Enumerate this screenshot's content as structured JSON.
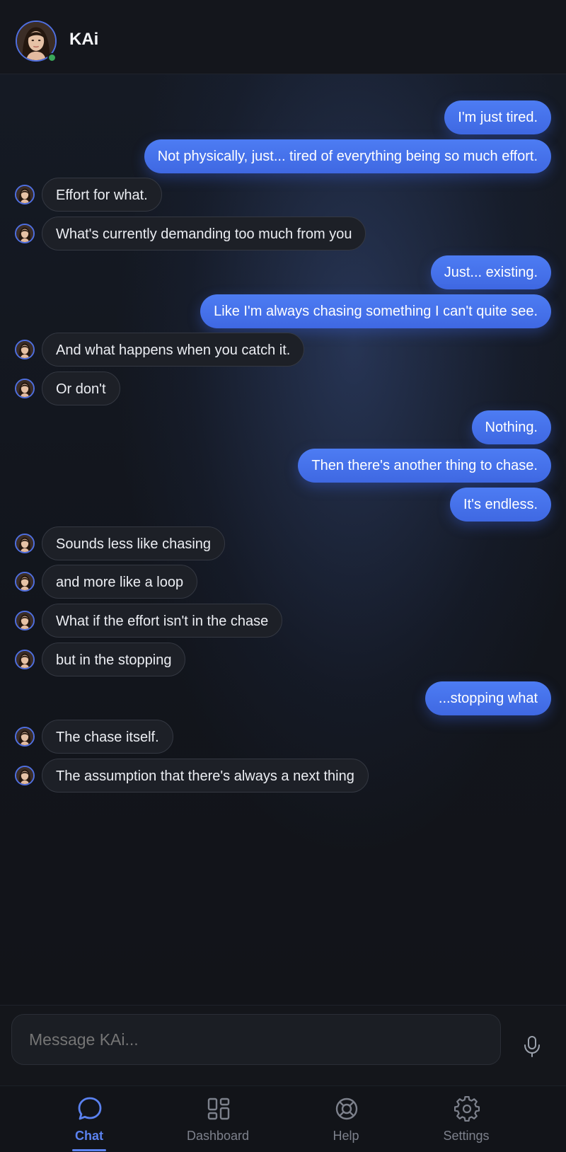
{
  "header": {
    "title": "KAi",
    "avatar_icon": "kai-avatar-portrait",
    "status": "online"
  },
  "messages": [
    {
      "sender": "user",
      "text": "I'm just tired."
    },
    {
      "sender": "user",
      "text": "Not physically, just... tired of everything being so much effort."
    },
    {
      "sender": "bot",
      "text": "Effort for what."
    },
    {
      "sender": "bot",
      "text": "What's currently demanding too much from you"
    },
    {
      "sender": "user",
      "text": "Just... existing."
    },
    {
      "sender": "user",
      "text": "Like I'm always chasing something I can't quite see."
    },
    {
      "sender": "bot",
      "text": "And what happens when you catch it."
    },
    {
      "sender": "bot",
      "text": "Or don't"
    },
    {
      "sender": "user",
      "text": "Nothing."
    },
    {
      "sender": "user",
      "text": "Then there's another thing to chase."
    },
    {
      "sender": "user",
      "text": "It's endless."
    },
    {
      "sender": "bot",
      "text": "Sounds less like chasing"
    },
    {
      "sender": "bot",
      "text": "and more like a loop"
    },
    {
      "sender": "bot",
      "text": "What if the effort isn't in the chase"
    },
    {
      "sender": "bot",
      "text": "but in the stopping"
    },
    {
      "sender": "user",
      "text": "...stopping what"
    },
    {
      "sender": "bot",
      "text": "The chase itself."
    },
    {
      "sender": "bot",
      "text": "The assumption that there's always a next thing"
    }
  ],
  "composer": {
    "placeholder": "Message KAi...",
    "mic_icon": "microphone-icon"
  },
  "nav": {
    "active": "chat",
    "items": [
      {
        "id": "chat",
        "label": "Chat",
        "icon": "chat-bubble-icon"
      },
      {
        "id": "dashboard",
        "label": "Dashboard",
        "icon": "dashboard-grid-icon"
      },
      {
        "id": "help",
        "label": "Help",
        "icon": "lifebuoy-icon"
      },
      {
        "id": "settings",
        "label": "Settings",
        "icon": "gear-icon"
      }
    ]
  },
  "colors": {
    "accent": "#5b82f0",
    "user_bubble": "#4470e8",
    "bot_bubble": "#1d2027",
    "online": "#3aa85a",
    "background": "#111318"
  }
}
